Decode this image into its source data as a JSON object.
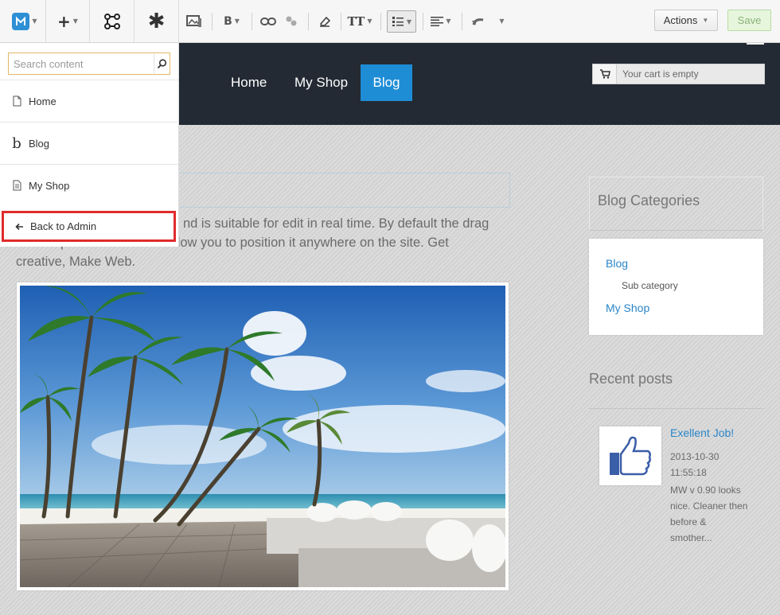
{
  "toolbar": {
    "actions_label": "Actions",
    "save_label": "Save",
    "text_size_label": "TT",
    "bold_label": "B"
  },
  "nav": {
    "items": [
      {
        "label": "Home",
        "active": false
      },
      {
        "label": "My Shop",
        "active": false
      },
      {
        "label": "Blog",
        "active": true
      }
    ],
    "active_color": "#1f8dd6"
  },
  "cart": {
    "text": "Your cart is empty"
  },
  "search": {
    "placeholder": "Search content"
  },
  "panel": {
    "items": [
      {
        "label": "Home",
        "icon": "page-icon"
      },
      {
        "label": "Blog",
        "icon": "blog-b-icon"
      },
      {
        "label": "My Shop",
        "icon": "document-icon"
      }
    ],
    "back_to_admin": "Back to Admin",
    "highlight_color": "#e02b2b"
  },
  "main": {
    "intro_visible": "nd is suitable for edit in real time. By default the drag",
    "intro_line2": "and drop core feature will allow you to position it anywhere on the site. Get",
    "intro_line3": "creative, Make Web."
  },
  "sidebar": {
    "categories_title": "Blog Categories",
    "categories": [
      {
        "label": "Blog",
        "level": 0
      },
      {
        "label": "Sub category",
        "level": 1
      },
      {
        "label": "My Shop",
        "level": 0
      }
    ],
    "recent_title": "Recent posts",
    "post": {
      "title": "Exellent Job!",
      "date": "2013-10-30",
      "time": "11:55:18",
      "excerpt_lines": [
        "MW v 0.90 looks",
        "nice. Cleaner then",
        "before &",
        "smother..."
      ]
    }
  }
}
